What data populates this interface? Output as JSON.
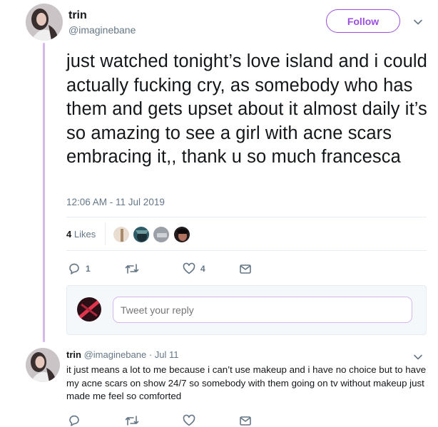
{
  "tweet": {
    "author_name": "trin",
    "author_handle": "@imaginebane",
    "follow_label": "Follow",
    "text": "just watched tonight’s love island and i could actually fucking cry, as somebody who has them and gets upset about it almost daily it’s so amazing to see a girl with acne scars embracing it,, thank u so much francesca",
    "timestamp": "12:06 AM - 11 Jul 2019",
    "likes_count": "4",
    "likes_label": "Likes",
    "reply_count": "1",
    "like_count_action": "4"
  },
  "reply_composer": {
    "placeholder": "Tweet your reply"
  },
  "reply_tweet": {
    "author_name": "trin",
    "author_handle": "@imaginebane",
    "date": "· Jul 11",
    "text": "it just means a lot to me because i can’t use makeup and i have no choice but to have my acne scars on show 24/7 so somebody with them going on tv without makeup just made me feel so comforted"
  },
  "colors": {
    "accent": "#9b4fde",
    "thread_line": "#d5b8ee",
    "muted_text": "#657786"
  },
  "icons": [
    "chevron-down-icon",
    "reply-icon",
    "retweet-icon",
    "heart-icon",
    "message-icon"
  ]
}
